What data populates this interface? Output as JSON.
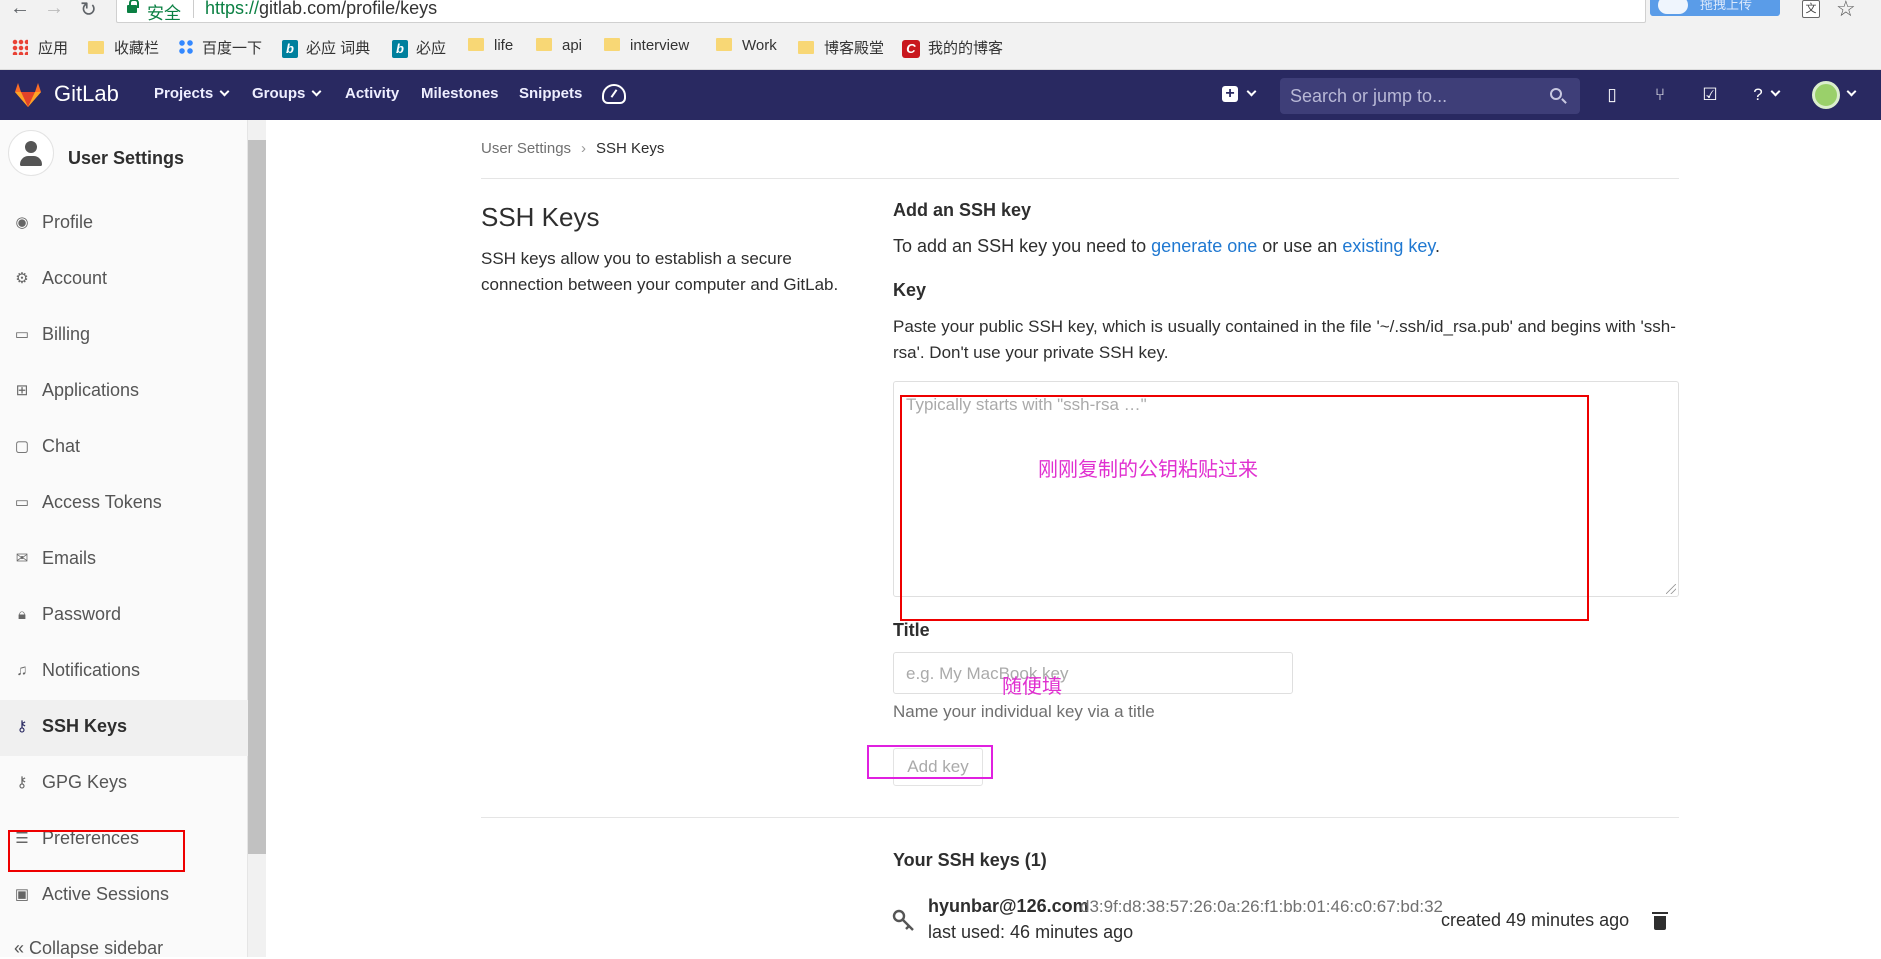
{
  "browser": {
    "secure_label": "安全",
    "url_proto": "https://",
    "url_rest": "gitlab.com/profile/keys",
    "ext_label": "拖拽上传",
    "bookmarks": [
      "应用",
      "收藏栏",
      "百度一下",
      "必应 词典",
      "必应",
      "life",
      "api",
      "interview",
      "Work",
      "博客殿堂",
      "我的的博客"
    ]
  },
  "header": {
    "brand": "GitLab",
    "nav": [
      "Projects",
      "Groups",
      "Activity",
      "Milestones",
      "Snippets"
    ],
    "search_placeholder": "Search or jump to..."
  },
  "sidebar": {
    "title": "User Settings",
    "items": [
      {
        "label": "Profile",
        "icon": "profile-icon"
      },
      {
        "label": "Account",
        "icon": "account-icon"
      },
      {
        "label": "Billing",
        "icon": "credit-card-icon"
      },
      {
        "label": "Applications",
        "icon": "applications-icon"
      },
      {
        "label": "Chat",
        "icon": "chat-icon"
      },
      {
        "label": "Access Tokens",
        "icon": "token-icon"
      },
      {
        "label": "Emails",
        "icon": "mail-icon"
      },
      {
        "label": "Password",
        "icon": "lock-icon"
      },
      {
        "label": "Notifications",
        "icon": "bell-icon"
      },
      {
        "label": "SSH Keys",
        "icon": "key-icon"
      },
      {
        "label": "GPG Keys",
        "icon": "key-icon"
      },
      {
        "label": "Preferences",
        "icon": "preferences-icon"
      },
      {
        "label": "Active Sessions",
        "icon": "monitor-icon"
      }
    ],
    "active": "SSH Keys",
    "collapse_label": "Collapse sidebar"
  },
  "breadcrumb": {
    "parent": "User Settings",
    "current": "SSH Keys"
  },
  "page": {
    "title": "SSH Keys",
    "description": "SSH keys allow you to establish a secure connection between your computer and GitLab."
  },
  "form": {
    "heading": "Add an SSH key",
    "intro_prefix": "To add an SSH key you need to ",
    "intro_link1": "generate one",
    "intro_mid": " or use an ",
    "intro_link2": "existing key",
    "intro_suffix": ".",
    "key_label": "Key",
    "key_help": "Paste your public SSH key, which is usually contained in the file '~/.ssh/id_rsa.pub' and begins with 'ssh-rsa'. Don't use your private SSH key.",
    "key_placeholder": "Typically starts with \"ssh-rsa …\"",
    "title_label": "Title",
    "title_placeholder": "e.g. My MacBook key",
    "title_help": "Name your individual key via a title",
    "submit_label": "Add key"
  },
  "annotations": {
    "key_note": "刚刚复制的公钥粘贴过来",
    "title_note": "随便填"
  },
  "keys": {
    "heading": "Your SSH keys (1)",
    "list": [
      {
        "email": "hyunbar@126.com",
        "fingerprint": "d3:9f:d8:38:57:26:0a:26:f1:bb:01:46:c0:67:bd:32",
        "last_used": "last used: 46 minutes ago",
        "created": "created 49 minutes ago"
      }
    ]
  },
  "colors": {
    "header_bg": "#292961",
    "link": "#1f78d1",
    "annotation_red": "#ee0000",
    "annotation_magenta": "#e020e0"
  }
}
